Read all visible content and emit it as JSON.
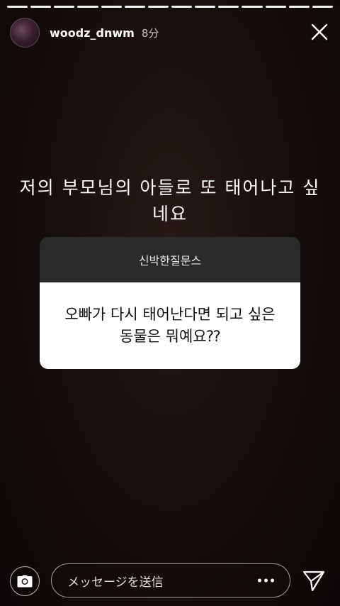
{
  "story": {
    "progress_segments": 14,
    "username": "woodz_dnwm",
    "time": "8分",
    "caption": "저의 부모님의 아들로 또 태어나고 싶네요"
  },
  "question_card": {
    "header": "신박한질문스",
    "question": "오빠가 다시 태어난다면 되고 싶은 동물은 뭐예요⁇"
  },
  "footer": {
    "message_placeholder": "メッセージを送信"
  },
  "icons": {
    "close": "close-icon",
    "camera": "camera-icon",
    "more": "more-icon",
    "send": "send-icon"
  },
  "colors": {
    "background": "#160e0c",
    "card_header": "#2a2a2a",
    "card_body": "#ffffff"
  }
}
